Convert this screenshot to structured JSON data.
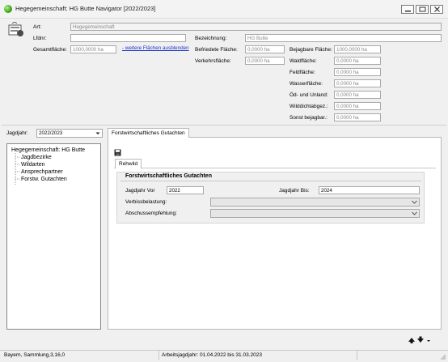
{
  "window": {
    "title": "Hegegemeinschaft: HG Butte Navigator [2022/2023]"
  },
  "header": {
    "art_label": "Art:",
    "art_value": "Hegegemeinschaft",
    "lfdnr_label": "Lfdnr:",
    "lfdnr_value": "",
    "gesamt_label": "Gesamtfläche:",
    "gesamt_value": "1000,0000 ha",
    "more_areas_link": "- weitere Flächen ausblenden",
    "bezeichnung_label": "Bezeichnung:",
    "bezeichnung_value": "HG Butte",
    "befriedete_label": "Befriedete Fläche:",
    "befriedete_value": "0,0000 ha",
    "verkehr_label": "Verkehrsfläche:",
    "verkehr_value": "0,0000 ha",
    "bejagbar_label": "Bejagbare Fläche:",
    "bejagbar_value": "1000,0000 ha",
    "wald_label": "Waldfläche:",
    "wald_value": "0,0000 ha",
    "feld_label": "Feldfläche:",
    "feld_value": "0,0000 ha",
    "wasser_label": "Wasserfläche:",
    "wasser_value": "0,0000 ha",
    "oed_label": "Öd- und Unland:",
    "oed_value": "0,0000 ha",
    "wilddicht_label": "Wilddichtabgez.:",
    "wilddicht_value": "0,0000 ha",
    "sonst_label": "Sonst bejagbar.:",
    "sonst_value": "0,0000 ha"
  },
  "jagdjahr": {
    "label": "Jagdjahr:",
    "value": "2022/2023"
  },
  "tree": {
    "root": "Hegegemeinschaft: HG Butte",
    "items": [
      "Jagdbezirke",
      "Wildarten",
      "Ansprechpartner",
      "Forstw. Gutachten"
    ]
  },
  "main_tab": "Forstwirtschaftliches Gutachten",
  "inner_tab": "Rehwild",
  "group": {
    "title": "Forstwirtschaftliches Gutachten",
    "jagdjahr_vor_label": "Jagdjahr Vor",
    "jagdjahr_vor_value": "2022",
    "jagdjahr_bis_label": "Jagdjahr Bis:",
    "jagdjahr_bis_value": "2024",
    "verbiss_label": "Verbissbelastung:",
    "verbiss_value": "",
    "abschuss_label": "Abschussempfehlung:",
    "abschuss_value": ""
  },
  "status": {
    "left": "Bayern, Sammlung,3,16,0",
    "middle": "Arbeitsjagdjahr: 01.04.2022 bis 31.03.2023"
  },
  "colors": {
    "accent": "#1a33cc",
    "app_icon": "#3aa61b"
  }
}
